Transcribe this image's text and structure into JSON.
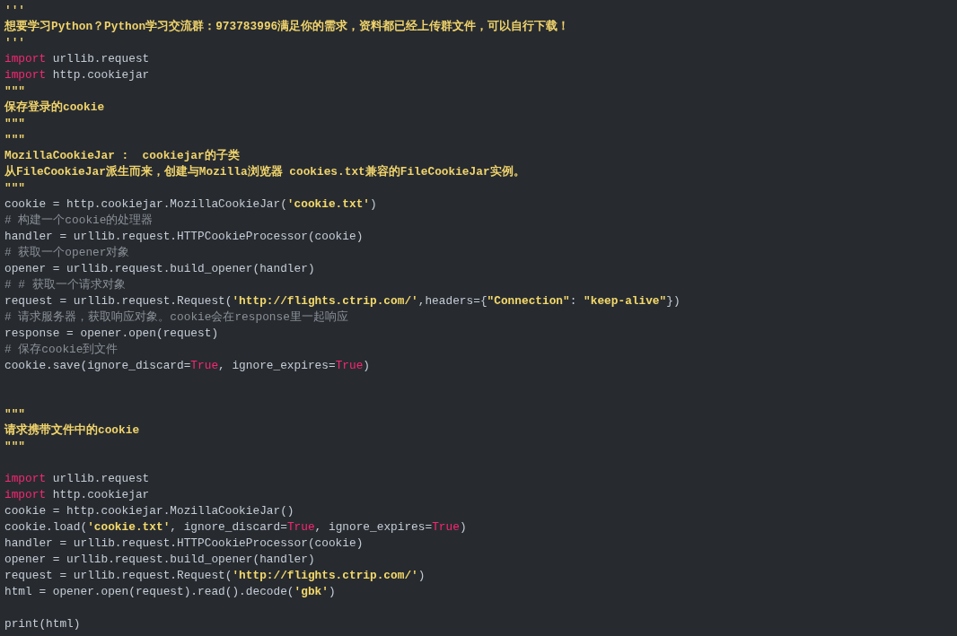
{
  "code_lines": [
    {
      "kind": "code",
      "tokens": [
        {
          "kind": "docstring",
          "text": "'''"
        }
      ]
    },
    {
      "kind": "code",
      "tokens": [
        {
          "kind": "docstring",
          "text": "想要学习Python？Python学习交流群：973783996满足你的需求，资料都已经上传群文件，可以自行下载！"
        }
      ]
    },
    {
      "kind": "code",
      "tokens": [
        {
          "kind": "docstring",
          "text": "'''"
        }
      ]
    },
    {
      "kind": "code",
      "tokens": [
        {
          "kind": "keyword",
          "text": "import"
        },
        {
          "kind": "plain",
          "text": " urllib.request"
        }
      ]
    },
    {
      "kind": "code",
      "tokens": [
        {
          "kind": "keyword",
          "text": "import"
        },
        {
          "kind": "plain",
          "text": " http.cookiejar"
        }
      ]
    },
    {
      "kind": "code",
      "tokens": [
        {
          "kind": "docstring",
          "text": "\"\"\""
        }
      ]
    },
    {
      "kind": "code",
      "tokens": [
        {
          "kind": "docstring",
          "text": "保存登录的cookie"
        }
      ]
    },
    {
      "kind": "code",
      "tokens": [
        {
          "kind": "docstring",
          "text": "\"\"\""
        }
      ]
    },
    {
      "kind": "code",
      "tokens": [
        {
          "kind": "docstring",
          "text": "\"\"\""
        }
      ]
    },
    {
      "kind": "code",
      "tokens": [
        {
          "kind": "docstring",
          "text": "MozillaCookieJar :  cookiejar的子类"
        }
      ]
    },
    {
      "kind": "code",
      "tokens": [
        {
          "kind": "docstring",
          "text": "从FileCookieJar派生而来，创建与Mozilla浏览器 cookies.txt兼容的FileCookieJar实例。"
        }
      ]
    },
    {
      "kind": "code",
      "tokens": [
        {
          "kind": "docstring",
          "text": "\"\"\""
        }
      ]
    },
    {
      "kind": "code",
      "tokens": [
        {
          "kind": "plain",
          "text": "cookie = http.cookiejar.MozillaCookieJar("
        },
        {
          "kind": "string",
          "text": "'cookie.txt'"
        },
        {
          "kind": "plain",
          "text": ")"
        }
      ]
    },
    {
      "kind": "code",
      "tokens": [
        {
          "kind": "comment",
          "text": "# 构建一个cookie的处理器"
        }
      ]
    },
    {
      "kind": "code",
      "tokens": [
        {
          "kind": "plain",
          "text": "handler = urllib.request.HTTPCookieProcessor(cookie)"
        }
      ]
    },
    {
      "kind": "code",
      "tokens": [
        {
          "kind": "comment",
          "text": "# 获取一个opener对象"
        }
      ]
    },
    {
      "kind": "code",
      "tokens": [
        {
          "kind": "plain",
          "text": "opener = urllib.request.build_opener(handler)"
        }
      ]
    },
    {
      "kind": "code",
      "tokens": [
        {
          "kind": "comment",
          "text": "# # 获取一个请求对象"
        }
      ]
    },
    {
      "kind": "code",
      "tokens": [
        {
          "kind": "plain",
          "text": "request = urllib.request.Request("
        },
        {
          "kind": "string",
          "text": "'http://flights.ctrip.com/'"
        },
        {
          "kind": "plain",
          "text": ",headers={"
        },
        {
          "kind": "string",
          "text": "\"Connection\""
        },
        {
          "kind": "plain",
          "text": ": "
        },
        {
          "kind": "string",
          "text": "\"keep-alive\""
        },
        {
          "kind": "plain",
          "text": "})"
        }
      ]
    },
    {
      "kind": "code",
      "tokens": [
        {
          "kind": "comment",
          "text": "# 请求服务器，获取响应对象。cookie会在response里一起响应"
        }
      ]
    },
    {
      "kind": "code",
      "tokens": [
        {
          "kind": "plain",
          "text": "response = opener.open(request)"
        }
      ]
    },
    {
      "kind": "code",
      "tokens": [
        {
          "kind": "comment",
          "text": "# 保存cookie到文件"
        }
      ]
    },
    {
      "kind": "code",
      "tokens": [
        {
          "kind": "plain",
          "text": "cookie.save(ignore_discard="
        },
        {
          "kind": "keyword",
          "text": "True"
        },
        {
          "kind": "plain",
          "text": ", ignore_expires="
        },
        {
          "kind": "keyword",
          "text": "True"
        },
        {
          "kind": "plain",
          "text": ")"
        }
      ]
    },
    {
      "kind": "blank"
    },
    {
      "kind": "blank"
    },
    {
      "kind": "code",
      "tokens": [
        {
          "kind": "docstring",
          "text": "\"\"\""
        }
      ]
    },
    {
      "kind": "code",
      "tokens": [
        {
          "kind": "docstring",
          "text": "请求携带文件中的cookie"
        }
      ]
    },
    {
      "kind": "code",
      "tokens": [
        {
          "kind": "docstring",
          "text": "\"\"\""
        }
      ]
    },
    {
      "kind": "blank"
    },
    {
      "kind": "code",
      "tokens": [
        {
          "kind": "keyword",
          "text": "import"
        },
        {
          "kind": "plain",
          "text": " urllib.request"
        }
      ]
    },
    {
      "kind": "code",
      "tokens": [
        {
          "kind": "keyword",
          "text": "import"
        },
        {
          "kind": "plain",
          "text": " http.cookiejar"
        }
      ]
    },
    {
      "kind": "code",
      "tokens": [
        {
          "kind": "plain",
          "text": "cookie = http.cookiejar.MozillaCookieJar()"
        }
      ]
    },
    {
      "kind": "code",
      "tokens": [
        {
          "kind": "plain",
          "text": "cookie.load("
        },
        {
          "kind": "string",
          "text": "'cookie.txt'"
        },
        {
          "kind": "plain",
          "text": ", ignore_discard="
        },
        {
          "kind": "keyword",
          "text": "True"
        },
        {
          "kind": "plain",
          "text": ", ignore_expires="
        },
        {
          "kind": "keyword",
          "text": "True"
        },
        {
          "kind": "plain",
          "text": ")"
        }
      ]
    },
    {
      "kind": "code",
      "tokens": [
        {
          "kind": "plain",
          "text": "handler = urllib.request.HTTPCookieProcessor(cookie)"
        }
      ]
    },
    {
      "kind": "code",
      "tokens": [
        {
          "kind": "plain",
          "text": "opener = urllib.request.build_opener(handler)"
        }
      ]
    },
    {
      "kind": "code",
      "tokens": [
        {
          "kind": "plain",
          "text": "request = urllib.request.Request("
        },
        {
          "kind": "string",
          "text": "'http://flights.ctrip.com/'"
        },
        {
          "kind": "plain",
          "text": ")"
        }
      ]
    },
    {
      "kind": "code",
      "tokens": [
        {
          "kind": "plain",
          "text": "html = opener.open(request).read().decode("
        },
        {
          "kind": "string",
          "text": "'gbk'"
        },
        {
          "kind": "plain",
          "text": ")"
        }
      ]
    },
    {
      "kind": "blank"
    },
    {
      "kind": "code",
      "tokens": [
        {
          "kind": "plain",
          "text": "print(html)"
        }
      ]
    }
  ]
}
